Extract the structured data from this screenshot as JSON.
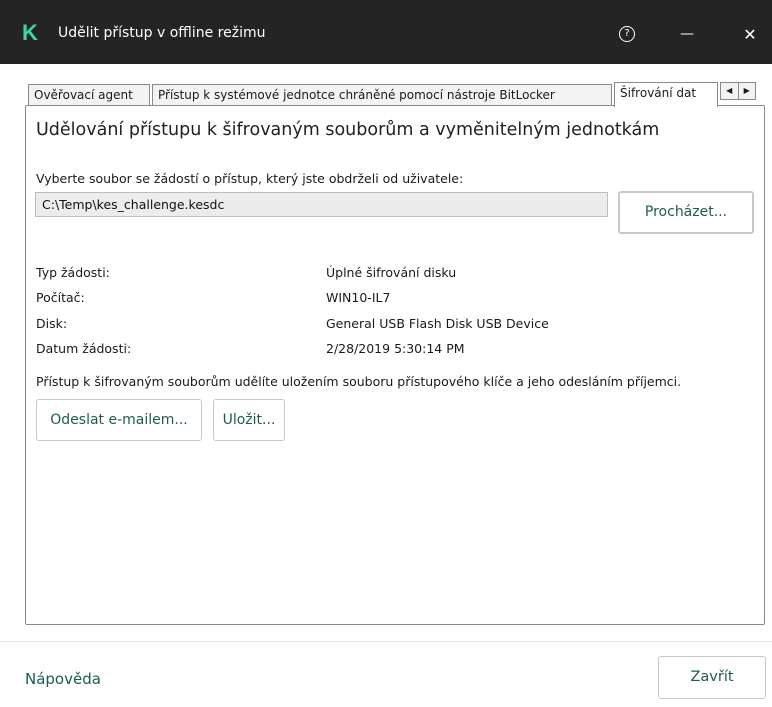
{
  "window": {
    "logo": "K",
    "title": "Udělit přístup v offline režimu",
    "help_glyph": "?",
    "minimize_glyph": "—",
    "close_glyph": "✕"
  },
  "tabs": [
    {
      "label": "Ověřovací agent",
      "active": false
    },
    {
      "label": "Přístup k systémové jednotce chráněné pomocí nástroje BitLocker",
      "active": false
    },
    {
      "label": "Šifrování dat",
      "active": true
    }
  ],
  "tab_scroll": {
    "left": "◀",
    "right": "▶"
  },
  "main": {
    "heading": "Udělování přístupu k šifrovaným souborům a vyměnitelným jednotkám",
    "prompt": "Vyberte soubor se žádostí o přístup, který jste obdrželi od uživatele:",
    "file_path": "C:\\Temp\\kes_challenge.kesdc",
    "browse_label": "Procházet...",
    "info": [
      {
        "label": "Typ žádosti:",
        "value": "Úplné šifrování disku"
      },
      {
        "label": "Počítač:",
        "value": "WIN10-IL7"
      },
      {
        "label": "Disk:",
        "value": "General USB Flash Disk USB Device"
      },
      {
        "label": "Datum žádosti:",
        "value": "2/28/2019 5:30:14 PM"
      }
    ],
    "note": "Přístup k šifrovaným souborům udělíte uložením souboru přístupového klíče a jeho odesláním příjemci.",
    "email_label": "Odeslat e-mailem...",
    "save_label": "Uložit..."
  },
  "footer": {
    "help_label": "Nápověda",
    "close_label": "Zavřít"
  },
  "colors": {
    "titlebar": "#242424",
    "logo": "#3dd6a2",
    "accent_text": "#1e5c4e"
  }
}
